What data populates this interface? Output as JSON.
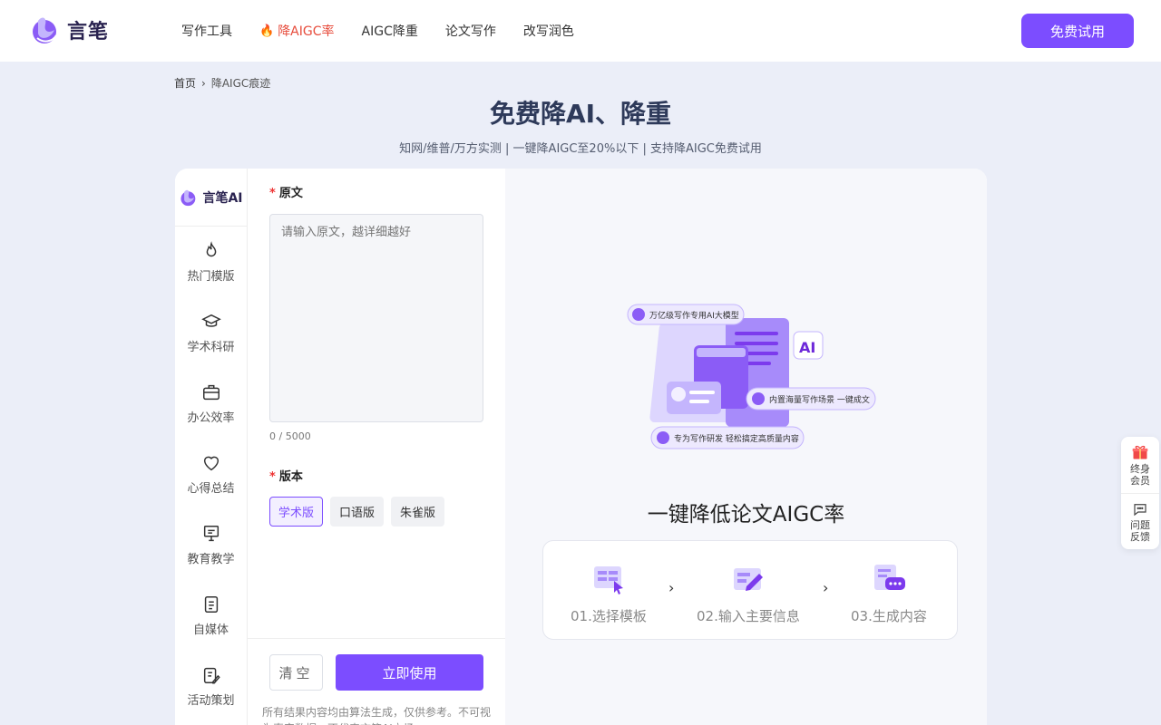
{
  "header": {
    "logo_text": "言笔",
    "nav": [
      {
        "label": "写作工具",
        "active": false
      },
      {
        "label": "降AIGC率",
        "active": true
      },
      {
        "label": "AIGC降重",
        "active": false
      },
      {
        "label": "论文写作",
        "active": false
      },
      {
        "label": "改写润色",
        "active": false
      }
    ],
    "trial_button": "免费试用"
  },
  "breadcrumb": {
    "home": "首页",
    "current": "降AIGC痕迹"
  },
  "page": {
    "title": "免费降AI、降重",
    "subtitle": "知网/维普/万方实测 | 一键降AIGC至20%以下 | 支持降AIGC免费试用"
  },
  "sidebar": {
    "logo_text": "言笔AI",
    "items": [
      {
        "label": "热门模版",
        "icon": "fire-icon"
      },
      {
        "label": "学术科研",
        "icon": "graduation-cap-icon"
      },
      {
        "label": "办公效率",
        "icon": "briefcase-icon"
      },
      {
        "label": "心得总结",
        "icon": "heart-icon"
      },
      {
        "label": "教育教学",
        "icon": "presentation-board-icon"
      },
      {
        "label": "自媒体",
        "icon": "document-icon"
      },
      {
        "label": "活动策划",
        "icon": "clipboard-pen-icon"
      }
    ]
  },
  "form": {
    "original_label": "原文",
    "original_placeholder": "请输入原文，越详细越好",
    "original_value": "",
    "counter": "0 / 5000",
    "version_label": "版本",
    "versions": [
      "学术版",
      "口语版",
      "朱雀版"
    ],
    "selected_version": "学术版",
    "clear_button": "清空",
    "use_button": "立即使用",
    "disclaimer": "所有结果内容均由算法生成，仅供参考。不可视为真实数据，不代表言笔AI立场。"
  },
  "preview": {
    "illustration": {
      "badge1": "万亿级写作专用AI大模型",
      "badge2": "内置海量写作场景 一键成文",
      "badge3": "专为写作研发 轻松搞定高质量内容",
      "ai_tag": "AI"
    },
    "title": "一键降低论文AIGC率",
    "steps": [
      {
        "label": "01.选择模板",
        "icon": "template-icon"
      },
      {
        "label": "02.输入主要信息",
        "icon": "edit-icon"
      },
      {
        "label": "03.生成内容",
        "icon": "chat-icon"
      }
    ]
  },
  "float_widget": {
    "items": [
      {
        "label": "终身会员",
        "icon": "gift-icon"
      },
      {
        "label": "问题反馈",
        "icon": "feedback-icon"
      }
    ]
  },
  "colors": {
    "accent": "#7c4dff",
    "active_nav": "#e74c3c",
    "background": "#ebeef8"
  }
}
